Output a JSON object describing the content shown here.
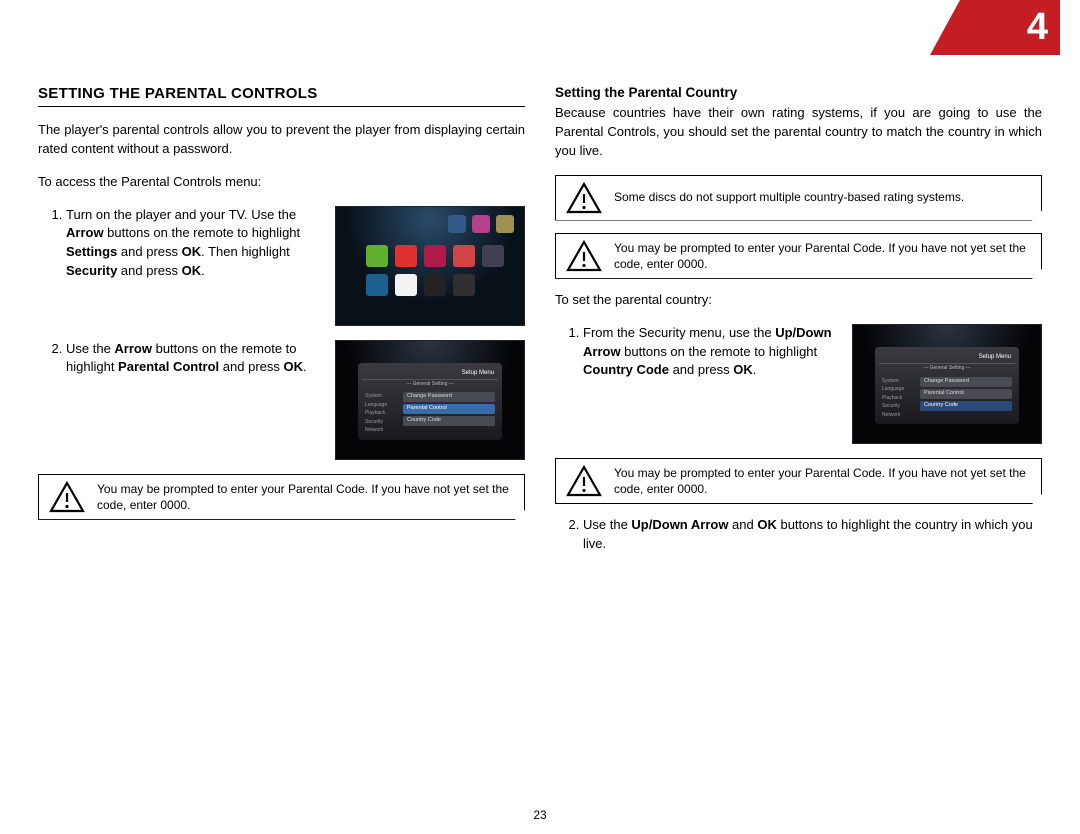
{
  "chapter_number": "4",
  "page_number": "23",
  "left": {
    "heading": "SETTING THE PARENTAL CONTROLS",
    "intro": "The player's parental controls allow you to prevent the player from displaying certain rated content without a password.",
    "access_line": "To access the Parental Controls menu:",
    "step1": {
      "a": "Turn on the player and your TV. Use the ",
      "b": "Arrow",
      "c": " buttons on the remote to highlight ",
      "d": "Settings",
      "e": " and press ",
      "f": "OK",
      "g": ". Then highlight ",
      "h": "Security",
      "i": " and press ",
      "j": "OK",
      "k": "."
    },
    "step2": {
      "a": "Use the ",
      "b": "Arrow",
      "c": " buttons on the remote to highlight ",
      "d": "Parental Control",
      "e": " and press ",
      "f": "OK",
      "g": "."
    },
    "note": "You may be prompted to enter your Parental Code. If you have not yet set the code, enter 0000.",
    "shot2": {
      "header": "Setup Menu",
      "sub": "--- General Setting ---",
      "left_items": [
        "System",
        "Language",
        "Playback",
        "Security",
        "Network"
      ],
      "items": [
        "Change Password",
        "Parental Control",
        "Country Code"
      ]
    }
  },
  "right": {
    "heading": "Setting the Parental Country",
    "intro": "Because countries have their own rating systems, if you are going to use the Parental Controls, you should set the parental country to match the country in which you live.",
    "note1": "Some discs do not support multiple country-based rating systems.",
    "note2": "You may be prompted to enter your Parental Code. If you have not yet set the code, enter 0000.",
    "set_line": "To set the parental country:",
    "step1": {
      "a": "From the Security menu, use the ",
      "b": "Up/Down Arrow",
      "c": " buttons on the remote to highlight ",
      "d": "Country Code",
      "e": " and press ",
      "f": "OK",
      "g": "."
    },
    "note3": "You may be prompted to enter your Parental Code. If you have not yet set the code, enter 0000.",
    "step2": {
      "a": "Use the ",
      "b": "Up/Down Arrow",
      "c": " and ",
      "d": "OK",
      "e": " buttons to highlight the country in which you live."
    },
    "shot": {
      "header": "Setup Menu",
      "sub": "--- General Setting ---",
      "left_items": [
        "System",
        "Language",
        "Playback",
        "Security",
        "Network"
      ],
      "items": [
        "Change Password",
        "Parental Control",
        "Country Code"
      ]
    }
  }
}
